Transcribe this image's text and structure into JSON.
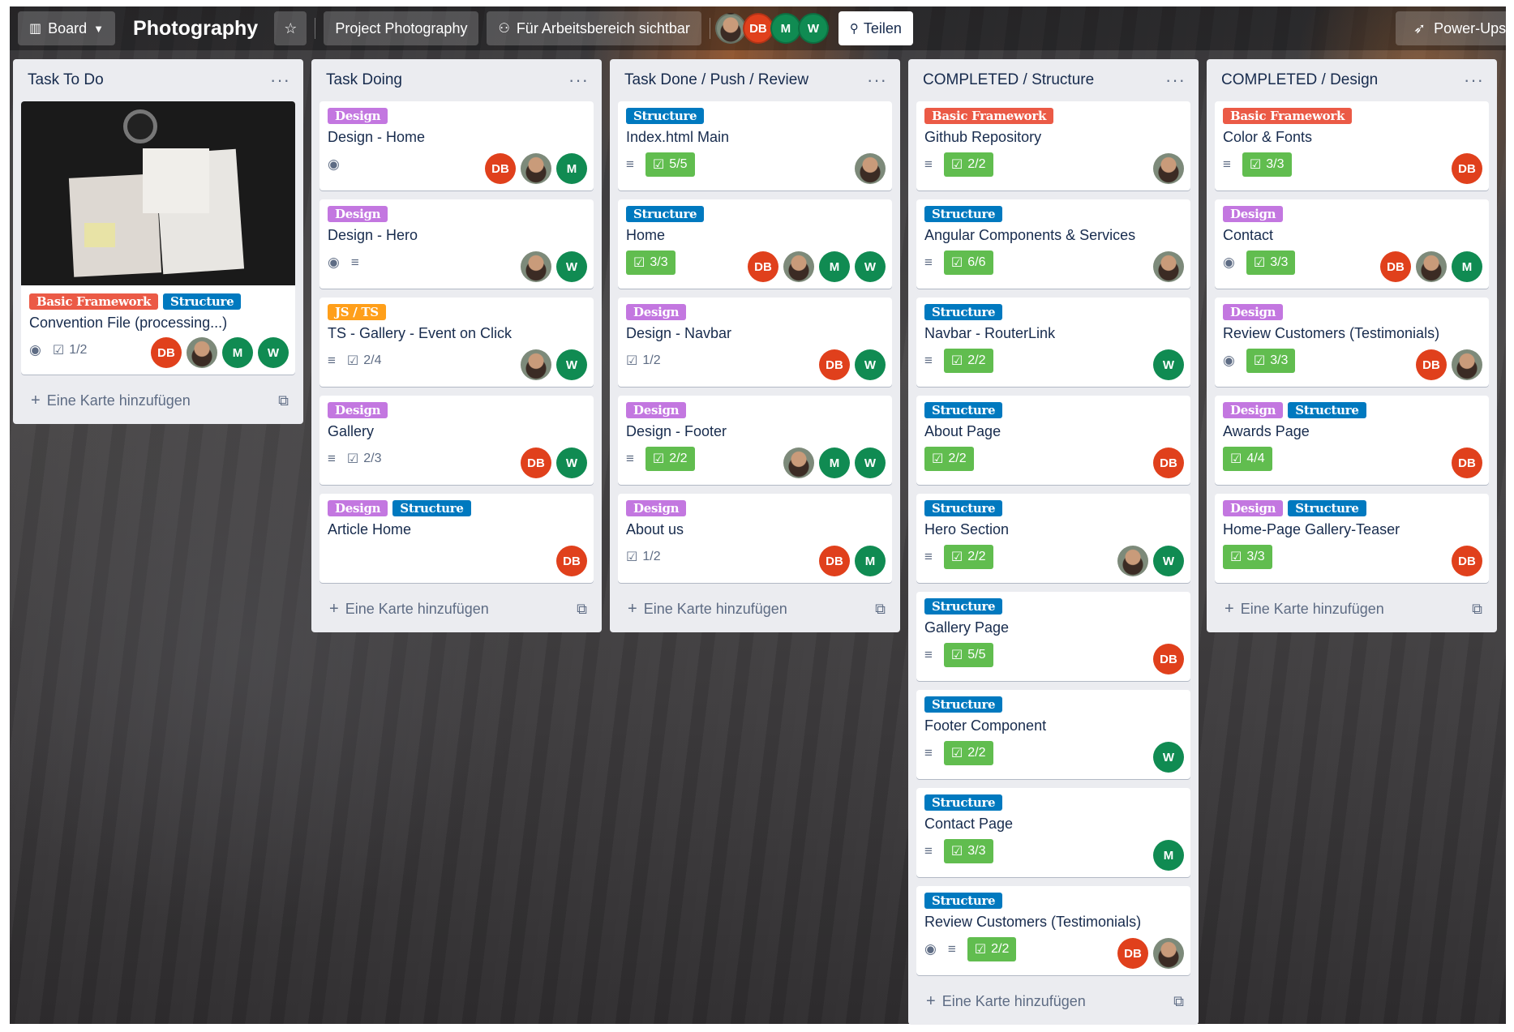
{
  "header": {
    "view_label": "Board",
    "board_title": "Photography",
    "workspace_label": "Project Photography",
    "visibility_label": "Für Arbeitsbereich sichtbar",
    "members": [
      "DB",
      "M",
      "W"
    ],
    "share_label": "Teilen",
    "powerups_label": "Power-Ups"
  },
  "add_card_label": "Eine Karte hinzufügen",
  "lists": [
    {
      "title": "Task To Do",
      "cards": [
        {
          "labels": [
            "Basic Framework",
            "Structure"
          ],
          "title": "Convention File (processing...)",
          "checklist": "1/2"
        }
      ]
    },
    {
      "title": "Task Doing",
      "cards": [
        {
          "labels": [
            "Design"
          ],
          "title": "Design - Home"
        },
        {
          "labels": [
            "Design"
          ],
          "title": "Design - Hero"
        },
        {
          "labels": [
            "JS / TS"
          ],
          "title": "TS - Gallery - Event on Click",
          "checklist": "2/4"
        },
        {
          "labels": [
            "Design"
          ],
          "title": "Gallery",
          "checklist": "2/3"
        },
        {
          "labels": [
            "Design",
            "Structure"
          ],
          "title": "Article Home"
        }
      ]
    },
    {
      "title": "Task Done / Push / Review",
      "cards": [
        {
          "labels": [
            "Structure"
          ],
          "title": "Index.html Main",
          "checklist": "5/5"
        },
        {
          "labels": [
            "Structure"
          ],
          "title": "Home",
          "checklist": "3/3"
        },
        {
          "labels": [
            "Design"
          ],
          "title": "Design - Navbar",
          "checklist": "1/2"
        },
        {
          "labels": [
            "Design"
          ],
          "title": "Design - Footer",
          "checklist": "2/2"
        },
        {
          "labels": [
            "Design"
          ],
          "title": "About us",
          "checklist": "1/2"
        }
      ]
    },
    {
      "title": "COMPLETED / Structure",
      "cards": [
        {
          "labels": [
            "Basic Framework"
          ],
          "title": "Github Repository",
          "checklist": "2/2"
        },
        {
          "labels": [
            "Structure"
          ],
          "title": "Angular Components & Services",
          "checklist": "6/6"
        },
        {
          "labels": [
            "Structure"
          ],
          "title": "Navbar - RouterLink",
          "checklist": "2/2"
        },
        {
          "labels": [
            "Structure"
          ],
          "title": "About Page",
          "checklist": "2/2"
        },
        {
          "labels": [
            "Structure"
          ],
          "title": "Hero Section",
          "checklist": "2/2"
        },
        {
          "labels": [
            "Structure"
          ],
          "title": "Gallery Page",
          "checklist": "5/5"
        },
        {
          "labels": [
            "Structure"
          ],
          "title": "Footer Component",
          "checklist": "2/2"
        },
        {
          "labels": [
            "Structure"
          ],
          "title": "Contact Page",
          "checklist": "3/3"
        },
        {
          "labels": [
            "Structure"
          ],
          "title": "Review Customers (Testimonials)",
          "checklist": "2/2"
        }
      ]
    },
    {
      "title": "COMPLETED / Design",
      "cards": [
        {
          "labels": [
            "Basic Framework"
          ],
          "title": "Color & Fonts",
          "checklist": "3/3"
        },
        {
          "labels": [
            "Design"
          ],
          "title": "Contact",
          "checklist": "3/3"
        },
        {
          "labels": [
            "Design"
          ],
          "title": "Review Customers (Testimonials)",
          "checklist": "3/3"
        },
        {
          "labels": [
            "Design",
            "Structure"
          ],
          "title": "Awards Page",
          "checklist": "4/4"
        },
        {
          "labels": [
            "Design",
            "Structure"
          ],
          "title": "Home-Page Gallery-Teaser",
          "checklist": "3/3"
        }
      ]
    }
  ],
  "colors": {
    "label_design": "#c377e0",
    "label_structure": "#0079bf",
    "label_basic_framework": "#eb5a46",
    "label_js_ts": "#ff9f1a",
    "checklist_complete": "#61bd4f",
    "avatar_db": "#e0401c",
    "avatar_m_w": "#108b52"
  }
}
